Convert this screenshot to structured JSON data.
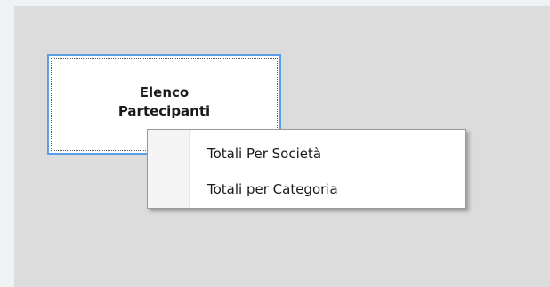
{
  "tile_button": {
    "label": "Elenco\nPartecipanti"
  },
  "context_menu": {
    "items": [
      {
        "label": "Totali Per Società"
      },
      {
        "label": "Totali per Categoria"
      }
    ]
  },
  "colors": {
    "page_background": "#eef2f5",
    "panel_background": "#dcdcdc",
    "focus_border": "#5a9fe3",
    "menu_background": "#ffffff",
    "text": "#1a1a1a"
  }
}
